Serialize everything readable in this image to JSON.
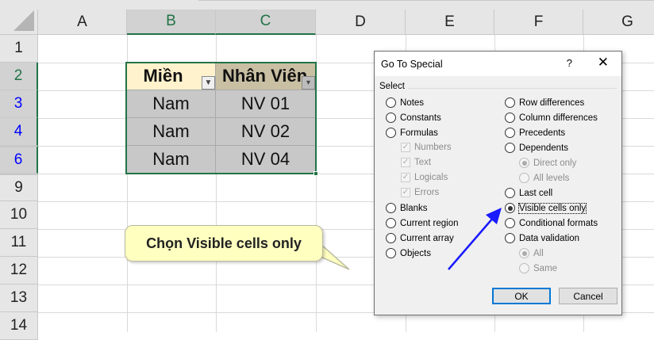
{
  "columns": [
    "A",
    "B",
    "C",
    "D",
    "E",
    "F",
    "G"
  ],
  "rows": [
    "1",
    "2",
    "3",
    "4",
    "6",
    "9",
    "10",
    "11",
    "12",
    "13",
    "14"
  ],
  "table": {
    "headers": [
      "Miền",
      "Nhân Viên"
    ],
    "data": [
      [
        "Nam",
        "NV 01"
      ],
      [
        "Nam",
        "NV 02"
      ],
      [
        "Nam",
        "NV 04"
      ]
    ]
  },
  "callout": "Chọn Visible cells only",
  "dialog": {
    "title": "Go To Special",
    "help": "?",
    "close": "✕",
    "group": "Select",
    "left_options": [
      "Notes",
      "Constants",
      "Formulas",
      "Blanks",
      "Current region",
      "Current array",
      "Objects"
    ],
    "formula_checks": [
      "Numbers",
      "Text",
      "Logicals",
      "Errors"
    ],
    "right_options": [
      "Row differences",
      "Column differences",
      "Precedents",
      "Dependents",
      "Last cell",
      "Visible cells only",
      "Conditional formats",
      "Data validation"
    ],
    "dependents_sub": [
      "Direct only",
      "All levels"
    ],
    "validation_sub": [
      "All",
      "Same"
    ],
    "selected": "Visible cells only",
    "ok": "OK",
    "cancel": "Cancel"
  },
  "colors": {
    "accent": "#217346",
    "arrow": "#1a1aff",
    "header_fill": "#fff2cc",
    "header2_fill": "#c9bfa3"
  }
}
